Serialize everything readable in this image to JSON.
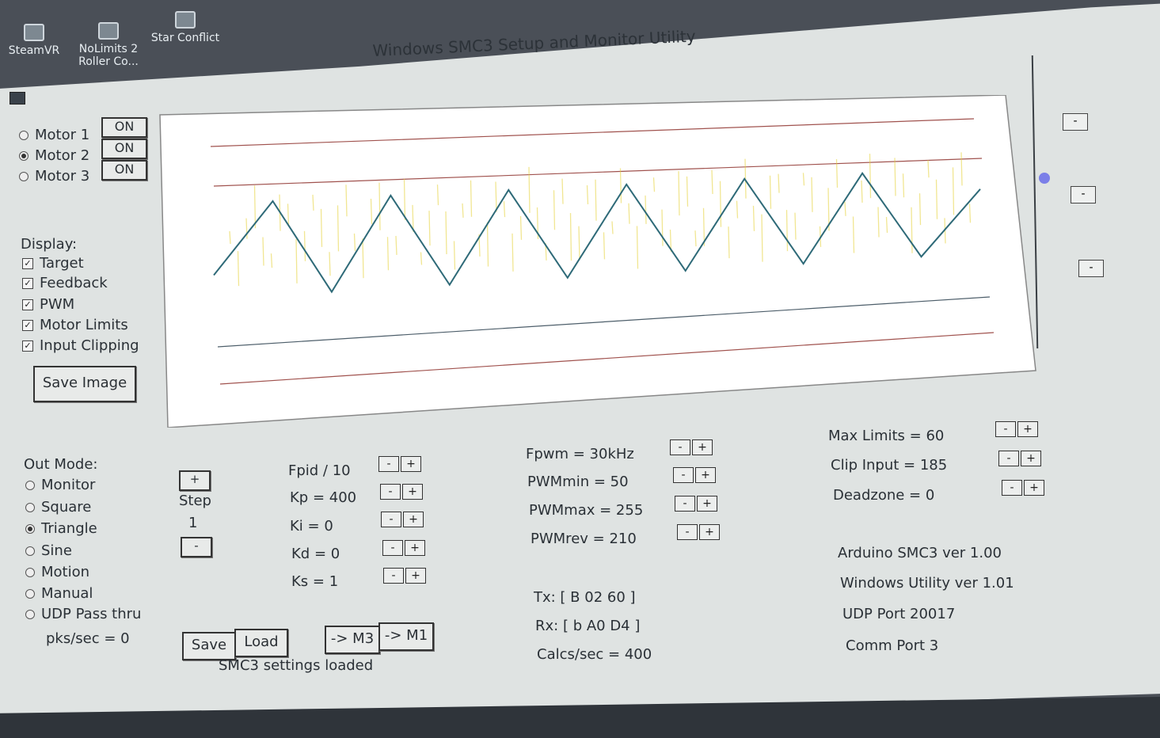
{
  "desktop": {
    "icons": [
      {
        "label_line1": "SteamVR",
        "label_line2": ""
      },
      {
        "label_line1": "NoLimits 2",
        "label_line2": "Roller Co..."
      },
      {
        "label_line1": "Star Conflict",
        "label_line2": ""
      }
    ]
  },
  "window": {
    "title": "Windows SMC3 Setup and Monitor Utility"
  },
  "motors": [
    {
      "label": "Motor 1",
      "selected": false,
      "button": "ON"
    },
    {
      "label": "Motor 2",
      "selected": true,
      "button": "ON"
    },
    {
      "label": "Motor 3",
      "selected": false,
      "button": "ON"
    }
  ],
  "display": {
    "heading": "Display:",
    "options": [
      {
        "label": "Target",
        "checked": true
      },
      {
        "label": "Feedback",
        "checked": true
      },
      {
        "label": "PWM",
        "checked": true
      },
      {
        "label": "Motor Limits",
        "checked": true
      },
      {
        "label": "Input Clipping",
        "checked": true
      }
    ],
    "save_image": "Save Image"
  },
  "out_mode": {
    "heading": "Out Mode:",
    "options": [
      {
        "label": "Monitor",
        "selected": false
      },
      {
        "label": "Square",
        "selected": false
      },
      {
        "label": "Triangle",
        "selected": true
      },
      {
        "label": "Sine",
        "selected": false
      },
      {
        "label": "Motion",
        "selected": false
      },
      {
        "label": "Manual",
        "selected": false
      },
      {
        "label": "UDP Pass thru",
        "selected": false
      }
    ],
    "pks": "pks/sec = 0"
  },
  "step": {
    "plus": "+",
    "label": "Step",
    "value": "1",
    "minus": "-"
  },
  "pid": {
    "fpid": "Fpid / 10",
    "kp": "Kp = 400",
    "ki": "Ki = 0",
    "kd": "Kd = 0",
    "ks": "Ks = 1"
  },
  "pwm": {
    "fpwm": "Fpwm = 30kHz",
    "pwmmin": "PWMmin = 50",
    "pwmmax": "PWMmax = 255",
    "pwmrev": "PWMrev = 210"
  },
  "limits": {
    "max": "Max Limits = 60",
    "clip": "Clip Input = 185",
    "deadzone": "Deadzone = 0"
  },
  "buttons": {
    "save": "Save",
    "load": "Load",
    "to_m3": "-> M3",
    "to_m1": "-> M1",
    "minus": "-",
    "plus": "+"
  },
  "status": {
    "loaded": "SMC3 settings loaded",
    "tx": "Tx: [ B 02 60 ]",
    "rx": "Rx: [ b A0 D4 ]",
    "calcs": "Calcs/sec = 400"
  },
  "info": {
    "arduino": "Arduino SMC3 ver 1.00",
    "windows": "Windows Utility ver 1.01",
    "udp": "UDP Port 20017",
    "comm": "Comm Port 3"
  },
  "colors": {
    "target_line": "#2e6a78",
    "pwm": "#e6d23a",
    "limit_line": "#a0524e",
    "clip_line": "#4d5e6a"
  },
  "chart_data": {
    "type": "line",
    "series": [
      {
        "values": [
          0.35,
          0.95,
          0.15,
          0.95,
          0.15,
          0.95,
          0.15,
          0.95,
          0.15,
          0.95,
          0.15,
          0.95,
          0.15,
          0.75
        ]
      }
    ]
  }
}
